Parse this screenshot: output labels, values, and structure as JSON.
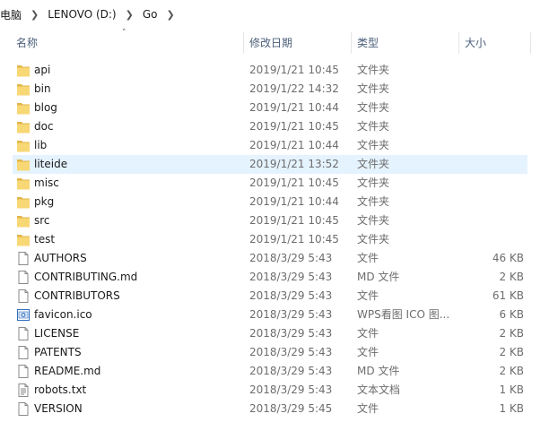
{
  "breadcrumb": [
    "电脑",
    "LENOVO (D:)",
    "Go"
  ],
  "columns": {
    "name": "名称",
    "date": "修改日期",
    "type": "类型",
    "size": "大小"
  },
  "rows": [
    {
      "name": "api",
      "date": "2019/1/21 10:45",
      "type": "文件夹",
      "size": "",
      "kind": "folder"
    },
    {
      "name": "bin",
      "date": "2019/1/22 14:32",
      "type": "文件夹",
      "size": "",
      "kind": "folder"
    },
    {
      "name": "blog",
      "date": "2019/1/21 10:44",
      "type": "文件夹",
      "size": "",
      "kind": "folder"
    },
    {
      "name": "doc",
      "date": "2019/1/21 10:45",
      "type": "文件夹",
      "size": "",
      "kind": "folder"
    },
    {
      "name": "lib",
      "date": "2019/1/21 10:44",
      "type": "文件夹",
      "size": "",
      "kind": "folder"
    },
    {
      "name": "liteide",
      "date": "2019/1/21 13:52",
      "type": "文件夹",
      "size": "",
      "kind": "folder",
      "hover": true
    },
    {
      "name": "misc",
      "date": "2019/1/21 10:45",
      "type": "文件夹",
      "size": "",
      "kind": "folder"
    },
    {
      "name": "pkg",
      "date": "2019/1/21 10:44",
      "type": "文件夹",
      "size": "",
      "kind": "folder"
    },
    {
      "name": "src",
      "date": "2019/1/21 10:45",
      "type": "文件夹",
      "size": "",
      "kind": "folder"
    },
    {
      "name": "test",
      "date": "2019/1/21 10:45",
      "type": "文件夹",
      "size": "",
      "kind": "folder"
    },
    {
      "name": "AUTHORS",
      "date": "2018/3/29 5:43",
      "type": "文件",
      "size": "46 KB",
      "kind": "file"
    },
    {
      "name": "CONTRIBUTING.md",
      "date": "2018/3/29 5:43",
      "type": "MD 文件",
      "size": "2 KB",
      "kind": "file"
    },
    {
      "name": "CONTRIBUTORS",
      "date": "2018/3/29 5:43",
      "type": "文件",
      "size": "61 KB",
      "kind": "file"
    },
    {
      "name": "favicon.ico",
      "date": "2018/3/29 5:43",
      "type": "WPS看图 ICO 图...",
      "size": "6 KB",
      "kind": "image"
    },
    {
      "name": "LICENSE",
      "date": "2018/3/29 5:43",
      "type": "文件",
      "size": "2 KB",
      "kind": "file"
    },
    {
      "name": "PATENTS",
      "date": "2018/3/29 5:43",
      "type": "文件",
      "size": "2 KB",
      "kind": "file"
    },
    {
      "name": "README.md",
      "date": "2018/3/29 5:43",
      "type": "MD 文件",
      "size": "2 KB",
      "kind": "file"
    },
    {
      "name": "robots.txt",
      "date": "2018/3/29 5:43",
      "type": "文本文档",
      "size": "1 KB",
      "kind": "text"
    },
    {
      "name": "VERSION",
      "date": "2018/3/29 5:45",
      "type": "文件",
      "size": "1 KB",
      "kind": "file"
    }
  ],
  "colors": {
    "folder": "#f8d775",
    "folder_dark": "#e2b54a",
    "hover": "#e5f3ff",
    "header_text": "#4c607a"
  }
}
